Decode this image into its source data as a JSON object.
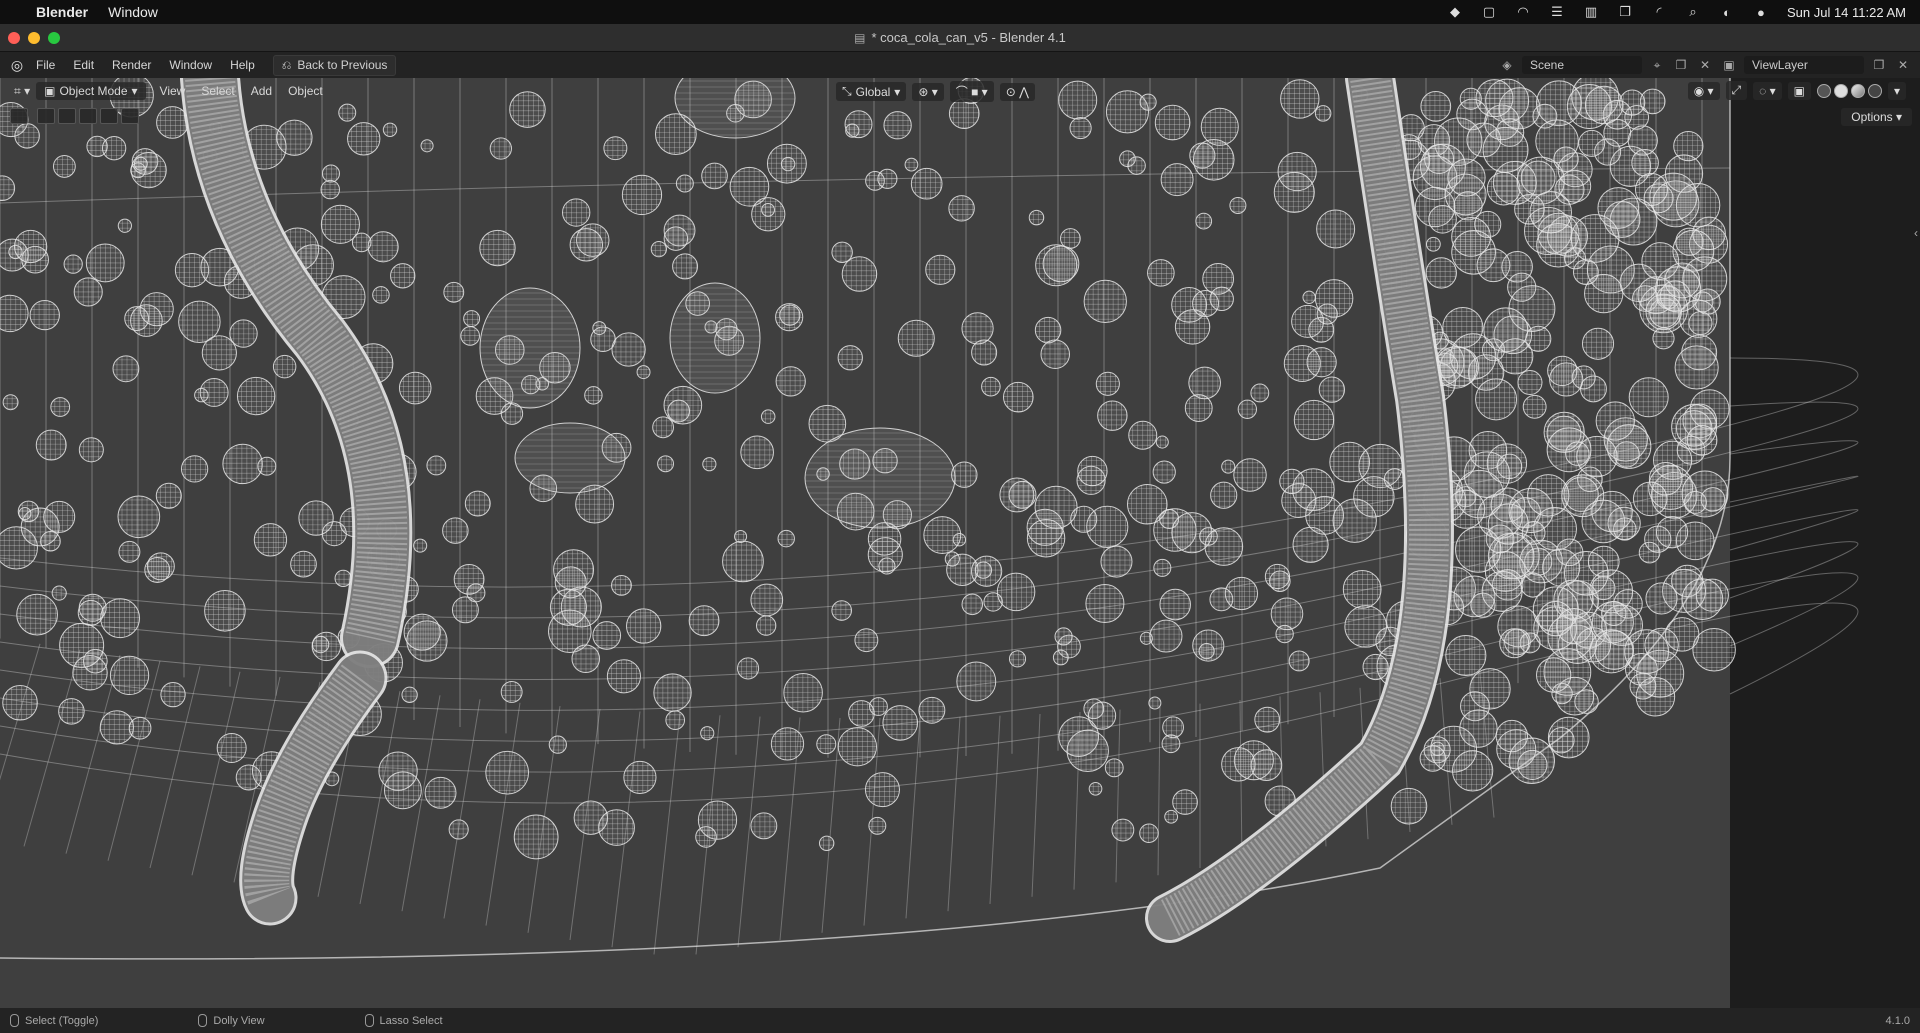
{
  "macmenu": {
    "app_name": "Blender",
    "menus": [
      "Window"
    ],
    "clock": "Sun Jul 14  11:22 AM"
  },
  "window": {
    "title": "* coca_cola_can_v5 - Blender 4.1"
  },
  "topbar": {
    "menus": [
      "File",
      "Edit",
      "Render",
      "Window",
      "Help"
    ],
    "back_label": "Back to Previous",
    "scene_label": "Scene",
    "viewlayer_label": "ViewLayer"
  },
  "viewport": {
    "mode_label": "Object Mode",
    "menus": [
      "View",
      "Select",
      "Add",
      "Object"
    ],
    "transform_label": "Global",
    "options_label": "Options"
  },
  "statusbar": {
    "select_label": "Select (Toggle)",
    "dolly_label": "Dolly View",
    "lasso_label": "Lasso Select",
    "version": "4.1.0"
  },
  "colors": {
    "wire": "#e8e8e8",
    "viewport_bg": "#3f3f3f"
  }
}
